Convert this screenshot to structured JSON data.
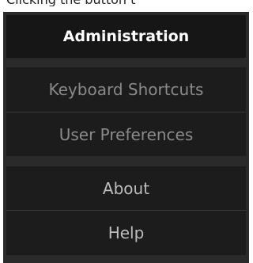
{
  "caption": "Clicking the     button t",
  "menu": {
    "title": "Administration",
    "items": [
      {
        "label": "Keyboard Shortcuts",
        "state": "disabled"
      },
      {
        "label": "User Preferences",
        "state": "disabled"
      },
      {
        "label": "About",
        "state": "enabled"
      },
      {
        "label": "Help",
        "state": "enabled"
      }
    ]
  }
}
